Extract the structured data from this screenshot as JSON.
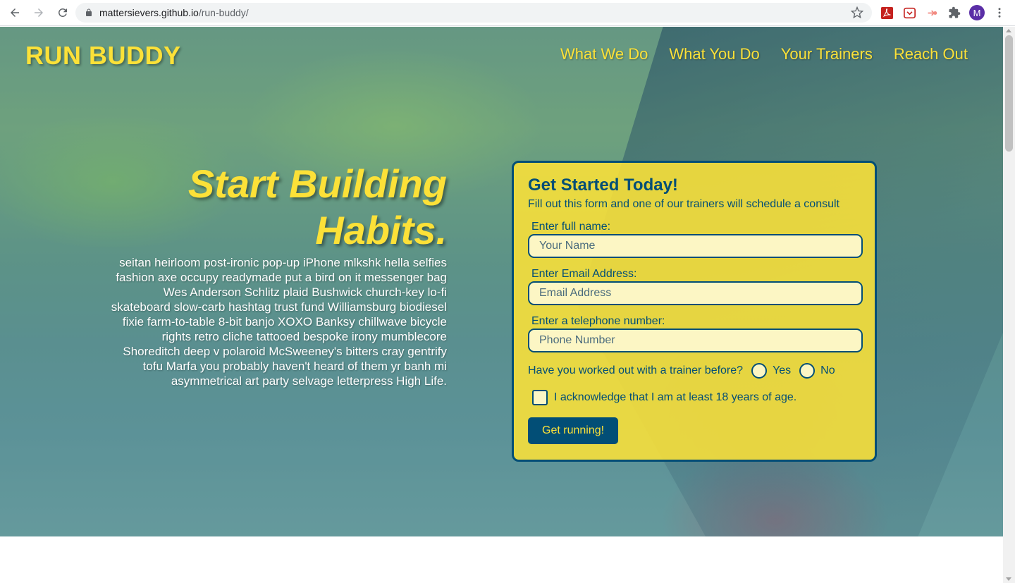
{
  "browser": {
    "url_host": "mattersievers.github.io",
    "url_path": "/run-buddy/",
    "avatar_letter": "M"
  },
  "header": {
    "brand": "RUN BUDDY",
    "nav": [
      "What We Do",
      "What You Do",
      "Your Trainers",
      "Reach Out"
    ]
  },
  "hero": {
    "heading_line1": "Start Building",
    "heading_line2": "Habits.",
    "body": "seitan heirloom post-ironic pop-up iPhone mlkshk hella selfies fashion axe occupy readymade put a bird on it messenger bag Wes Anderson Schlitz plaid Bushwick church-key lo-fi skateboard slow-carb hashtag trust fund Williamsburg biodiesel fixie farm-to-table 8-bit banjo XOXO Banksy chillwave bicycle rights retro cliche tattooed bespoke irony mumblecore Shoreditch deep v polaroid McSweeney's bitters cray gentrify tofu Marfa you probably haven't heard of them yr banh mi asymmetrical art party selvage letterpress High Life."
  },
  "form": {
    "title": "Get Started Today!",
    "subtitle": "Fill out this form and one of our trainers will schedule a consult",
    "name_label": "Enter full name:",
    "name_placeholder": "Your Name",
    "email_label": "Enter Email Address:",
    "email_placeholder": "Email Address",
    "phone_label": "Enter a telephone number:",
    "phone_placeholder": "Phone Number",
    "trainer_question": "Have you worked out with a trainer before?",
    "yes_label": "Yes",
    "no_label": "No",
    "age_ack": "I acknowledge that I am at least 18 years of age.",
    "submit_label": "Get running!"
  },
  "colors": {
    "brand_yellow": "#fce138",
    "brand_blue": "#024e76"
  }
}
